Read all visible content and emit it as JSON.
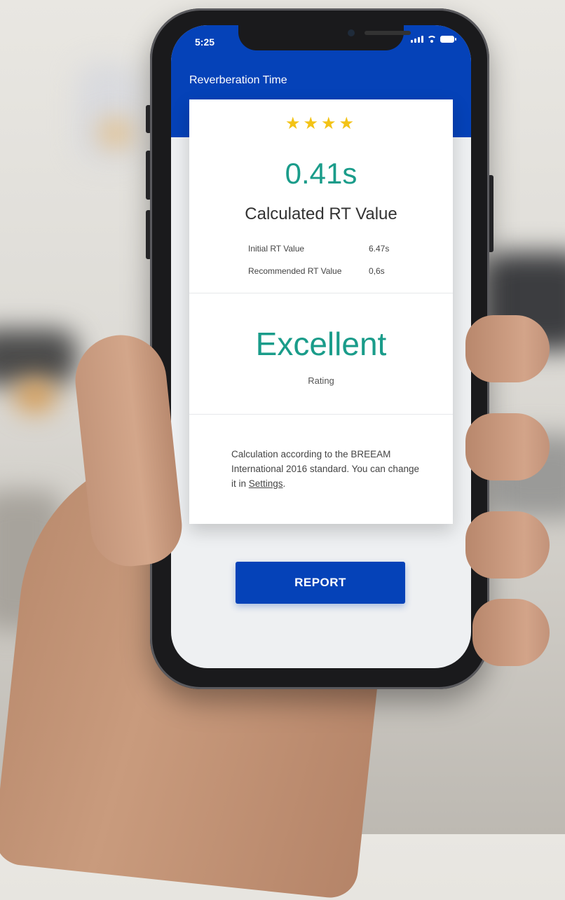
{
  "status_bar": {
    "time": "5:25"
  },
  "header": {
    "title": "Reverberation Time"
  },
  "result": {
    "stars": "★★★★",
    "rt_value": "0.41s",
    "rt_label": "Calculated RT Value",
    "initial_label": "Initial RT Value",
    "initial_value": "6.47s",
    "recommended_label": "Recommended RT Value",
    "recommended_value": "0,6s"
  },
  "rating": {
    "value": "Excellent",
    "label": "Rating"
  },
  "note": {
    "text": "Calculation according to the BREEAM International 2016 standard. You can change it in ",
    "link": "Settings",
    "suffix": "."
  },
  "actions": {
    "report_label": "REPORT"
  },
  "colors": {
    "primary": "#0542b8",
    "accent": "#1a9c8a",
    "star": "#f3c316"
  }
}
